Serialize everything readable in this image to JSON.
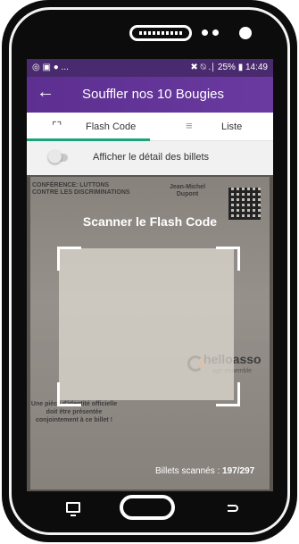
{
  "status_bar": {
    "left": "◎ ▣ ● ...",
    "right": "✖ ⍉ .∣ 25% ▮ 14:49"
  },
  "app_bar": {
    "back_icon": "arrow-left",
    "title": "Souffler nos 10 Bougies"
  },
  "tabs": [
    {
      "label": "Flash Code",
      "icon": "scan-frame",
      "selected": true
    },
    {
      "label": "Liste",
      "icon": "list",
      "selected": false
    }
  ],
  "toggle": {
    "label": "Afficher le détail des billets",
    "on": false
  },
  "scanner": {
    "title": "Scanner le Flash Code",
    "scanned_label": "Billets scannés : ",
    "scanned_value": "197/297"
  },
  "ticket_background": {
    "heading": "CONFÉRENCE: LUTTONS CONTRE LES DISCRIMINATIONS",
    "name": "Jean-Michel Dupont",
    "brand": "helloasso",
    "brand_tagline": "agir ensemble",
    "id_notice": "Une pièce d'identité officielle doit être présentée conjointement à ce billet !"
  },
  "colors": {
    "app_bar": "#5d2f90",
    "tab_indicator": "#1aa47a",
    "toggle_row_bg": "#f1f1f1"
  }
}
